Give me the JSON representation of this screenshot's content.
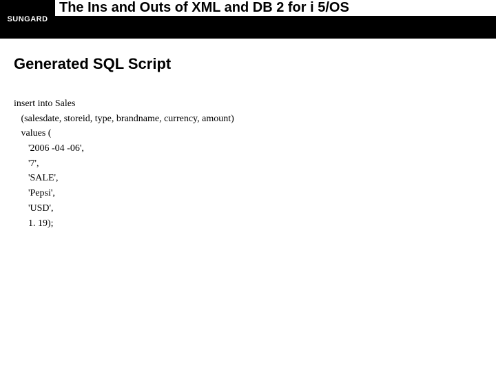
{
  "header": {
    "logo": "SUNGARD",
    "title": "The Ins and Outs of XML and DB 2 for i 5/OS"
  },
  "section": {
    "title": "Generated SQL Script"
  },
  "code": {
    "line1": "insert into Sales",
    "line2": "   (salesdate, storeid, type, brandname, currency, amount)",
    "line3": "   values (",
    "line4": "      '2006 -04 -06',",
    "line5": "      '7',",
    "line6": "      'SALE',",
    "line7": "      'Pepsi',",
    "line8": "      'USD',",
    "line9": "      1. 19);"
  }
}
